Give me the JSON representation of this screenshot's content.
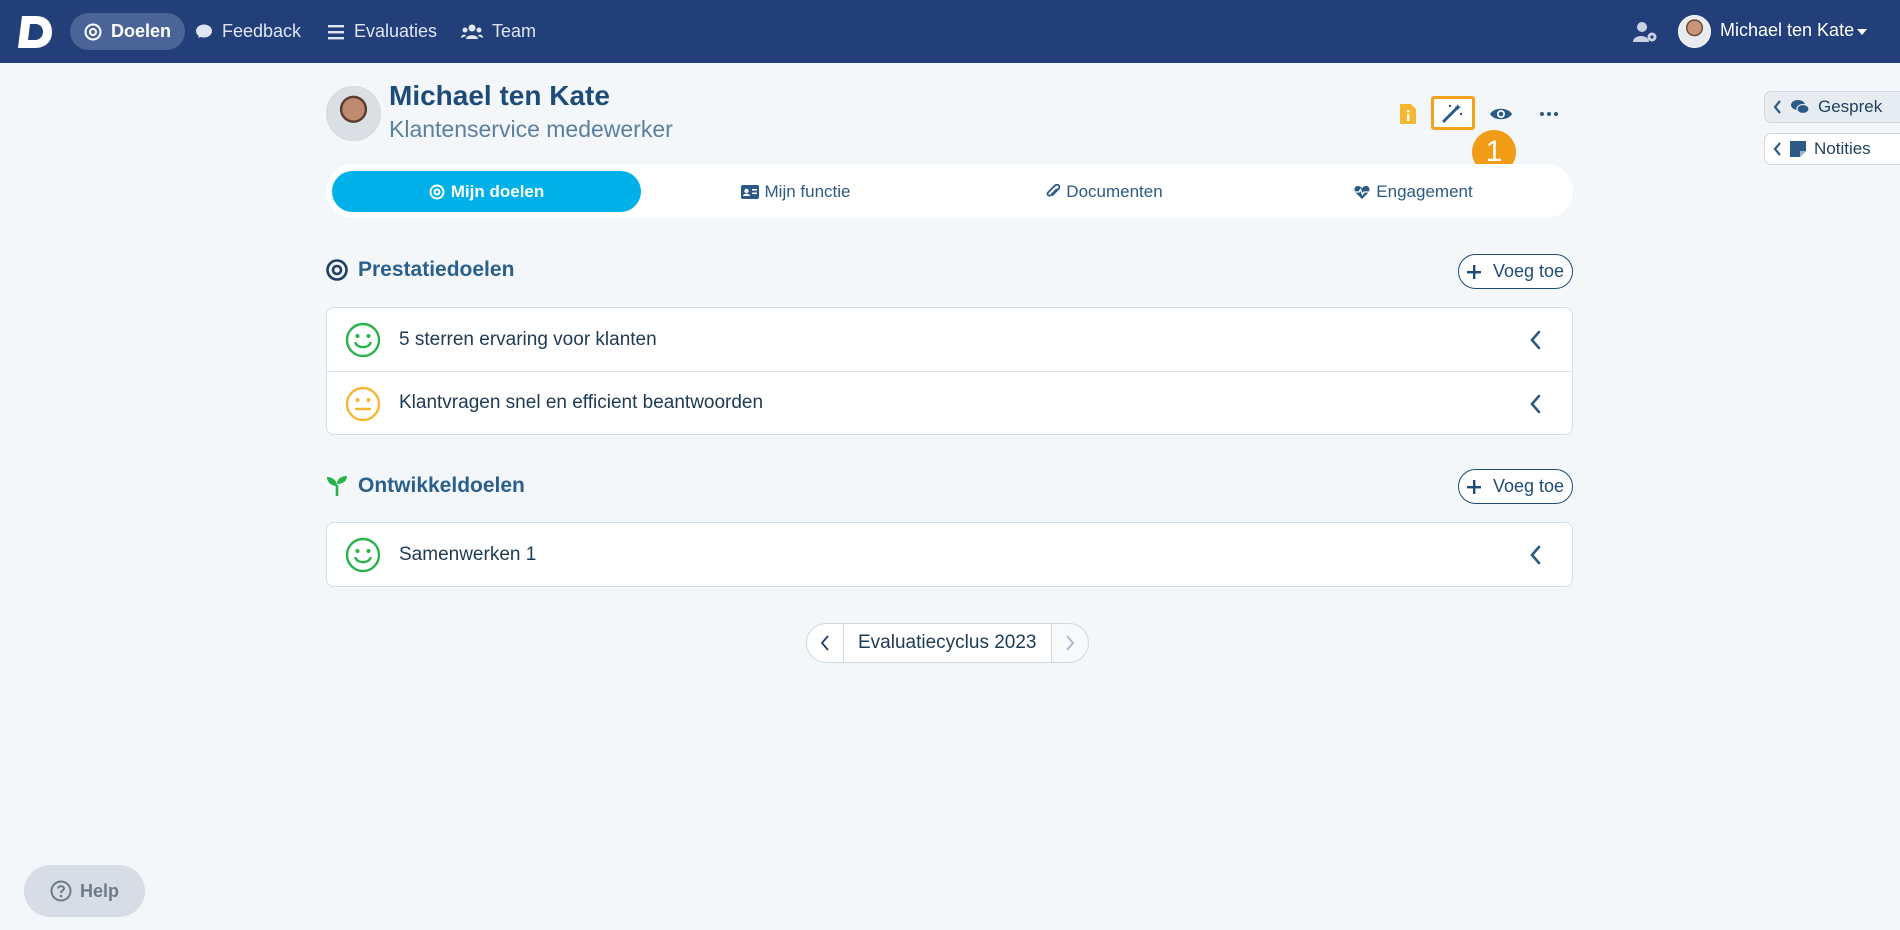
{
  "nav": {
    "items": [
      {
        "label": "Doelen",
        "icon": "target-icon"
      },
      {
        "label": "Feedback",
        "icon": "comment-icon"
      },
      {
        "label": "Evaluaties",
        "icon": "list-icon"
      },
      {
        "label": "Team",
        "icon": "users-icon"
      }
    ],
    "user_name": "Michael ten Kate"
  },
  "profile": {
    "name": "Michael ten Kate",
    "role": "Klantenservice medewerker"
  },
  "step_badge": "1",
  "side_tabs": {
    "gesprek": "Gesprek",
    "notities": "Notities"
  },
  "tabs": [
    {
      "label": "Mijn doelen",
      "icon": "target-icon"
    },
    {
      "label": "Mijn functie",
      "icon": "id-card-icon"
    },
    {
      "label": "Documenten",
      "icon": "paperclip-icon"
    },
    {
      "label": "Engagement",
      "icon": "heartbeat-icon"
    }
  ],
  "sections": {
    "performance": {
      "title": "Prestatiedoelen",
      "add_label": "Voeg toe",
      "items": [
        {
          "label": "5 sterren ervaring voor klanten",
          "status": "happy"
        },
        {
          "label": "Klantvragen snel en efficient beantwoorden",
          "status": "neutral"
        }
      ]
    },
    "development": {
      "title": "Ontwikkeldoelen",
      "add_label": "Voeg toe",
      "items": [
        {
          "label": "Samenwerken 1",
          "status": "happy"
        }
      ]
    }
  },
  "pager": {
    "label": "Evaluatiecyclus 2023"
  },
  "help": {
    "label": "Help"
  },
  "colors": {
    "topbar": "#223f7a",
    "accent": "#00b0e8",
    "happy": "#27b34a",
    "neutral": "#f5b731",
    "highlight": "#f5a11c"
  }
}
